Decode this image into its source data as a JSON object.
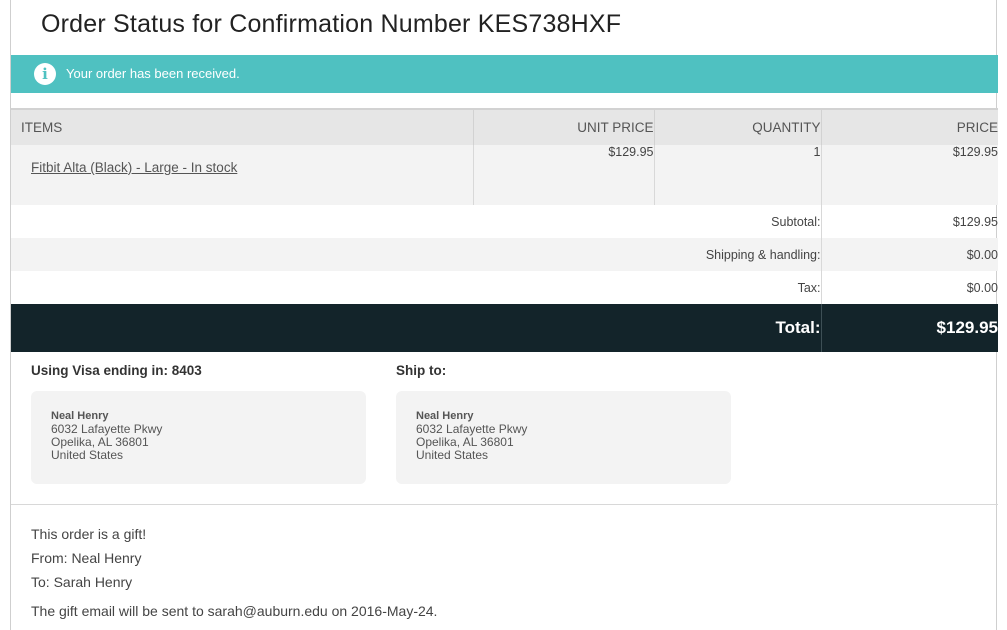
{
  "page": {
    "title": "Order Status for Confirmation Number KES738HXF"
  },
  "alert": {
    "icon": "info-icon",
    "message": "Your order has been received."
  },
  "table": {
    "headers": {
      "items": "ITEMS",
      "unit_price": "UNIT PRICE",
      "quantity": "QUANTITY",
      "price": "PRICE"
    },
    "rows": [
      {
        "item": "Fitbit Alta (Black) - Large - In stock",
        "unit_price": "$129.95",
        "quantity": "1",
        "price": "$129.95"
      }
    ],
    "summary": {
      "subtotal_label": "Subtotal:",
      "subtotal": "$129.95",
      "shipping_label": "Shipping & handling:",
      "shipping": "$0.00",
      "tax_label": "Tax:",
      "tax": "$0.00",
      "total_label": "Total:",
      "total": "$129.95"
    }
  },
  "payment": {
    "label": "Using Visa ending in: 8403",
    "address": {
      "name": "Neal Henry",
      "line1": "6032 Lafayette Pkwy",
      "line2": "Opelika, AL 36801",
      "country": "United States"
    }
  },
  "shipping": {
    "label": "Ship to:",
    "address": {
      "name": "Neal Henry",
      "line1": "6032 Lafayette Pkwy",
      "line2": "Opelika, AL 36801",
      "country": "United States"
    }
  },
  "gift": {
    "line1": "This order is a gift!",
    "from": "From: Neal Henry",
    "to": "To: Sarah Henry",
    "email_note": "The gift email will be sent to sarah@auburn.edu on 2016-May-24."
  },
  "colors": {
    "alert_bg": "#4fc1c1",
    "total_bg": "#13242a"
  }
}
